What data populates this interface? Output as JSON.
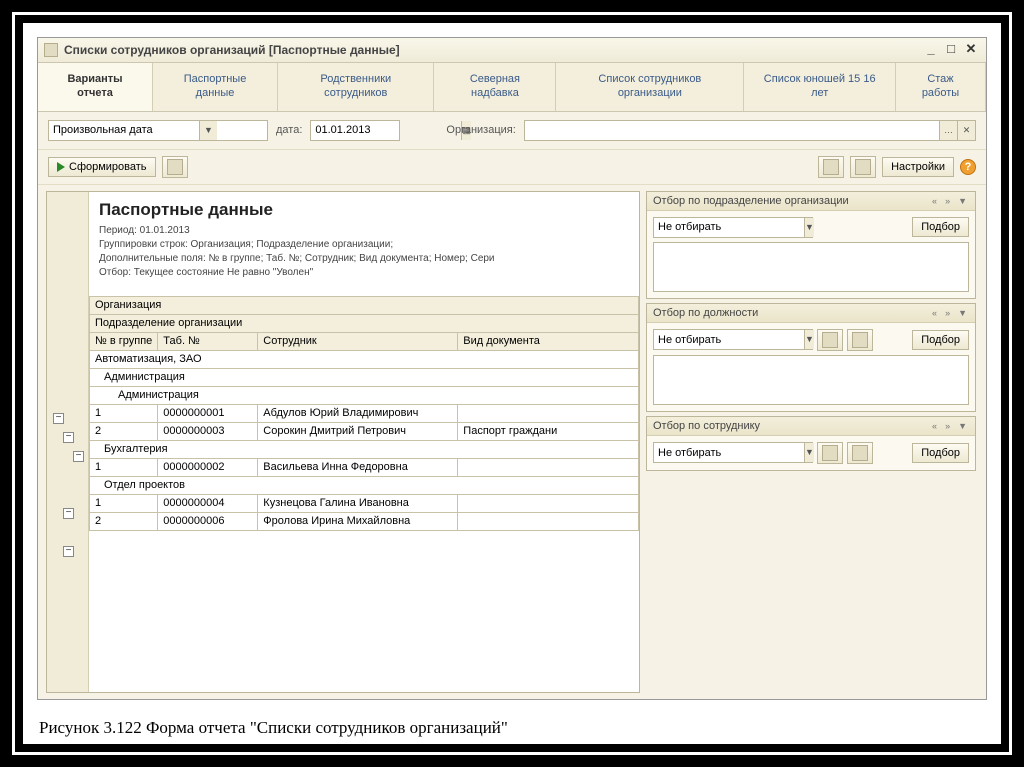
{
  "window": {
    "title": "Списки сотрудников организаций [Паспортные данные]"
  },
  "tabs": [
    {
      "label": "Варианты отчета"
    },
    {
      "label": "Паспортные данные"
    },
    {
      "label": "Родственники сотрудников"
    },
    {
      "label": "Северная надбавка"
    },
    {
      "label": "Список сотрудников организации"
    },
    {
      "label": "Список юношей 15 16 лет"
    },
    {
      "label": "Стаж работы"
    }
  ],
  "params": {
    "mode": "Произвольная дата",
    "date_label": "дата:",
    "date": "01.01.2013",
    "org_label": "Организация:",
    "org": ""
  },
  "toolbar": {
    "run_label": "Сформировать",
    "settings_label": "Настройки"
  },
  "report": {
    "title": "Паспортные данные",
    "period": "Период: 01.01.2013",
    "group_line": "Группировки строк: Организация; Подразделение организации;",
    "fields_line": "Дополнительные поля: № в группе; Таб. №; Сотрудник; Вид документа; Номер; Сери",
    "filter_line": "Отбор: Текущее состояние Не равно \"Уволен\"",
    "headers": {
      "org": "Организация",
      "dept": "Подразделение организации",
      "col1": "№ в группе",
      "col2": "Таб. №",
      "col3": "Сотрудник",
      "col4": "Вид документа"
    },
    "org_group": "Автоматизация, ЗАО",
    "groups": [
      {
        "name": "Администрация",
        "sub": "Администрация",
        "rows": [
          {
            "n": "1",
            "tab": "0000000001",
            "emp": "Абдулов Юрий Владимирович",
            "doc": ""
          },
          {
            "n": "2",
            "tab": "0000000003",
            "emp": "Сорокин Дмитрий Петрович",
            "doc": "Паспорт граждани"
          }
        ]
      },
      {
        "name": "Бухгалтерия",
        "sub": "",
        "rows": [
          {
            "n": "1",
            "tab": "0000000002",
            "emp": "Васильева Инна Федоровна",
            "doc": ""
          }
        ]
      },
      {
        "name": "Отдел проектов",
        "sub": "",
        "rows": [
          {
            "n": "1",
            "tab": "0000000004",
            "emp": "Кузнецова Галина Ивановна",
            "doc": ""
          },
          {
            "n": "2",
            "tab": "0000000006",
            "emp": "Фролова Ирина Михайловна",
            "doc": ""
          }
        ]
      }
    ]
  },
  "side": {
    "panels": [
      {
        "title": "Отбор по подразделение организации",
        "mode": "Не отбирать",
        "pick": "Подбор",
        "listH": 70
      },
      {
        "title": "Отбор по должности",
        "mode": "Не отбирать",
        "pick": "Подбор",
        "listH": 60
      },
      {
        "title": "Отбор по сотруднику",
        "mode": "Не отбирать",
        "pick": "Подбор",
        "listH": 20
      }
    ]
  },
  "caption": "Рисунок 3.122 Форма отчета \"Списки сотрудников организаций\""
}
